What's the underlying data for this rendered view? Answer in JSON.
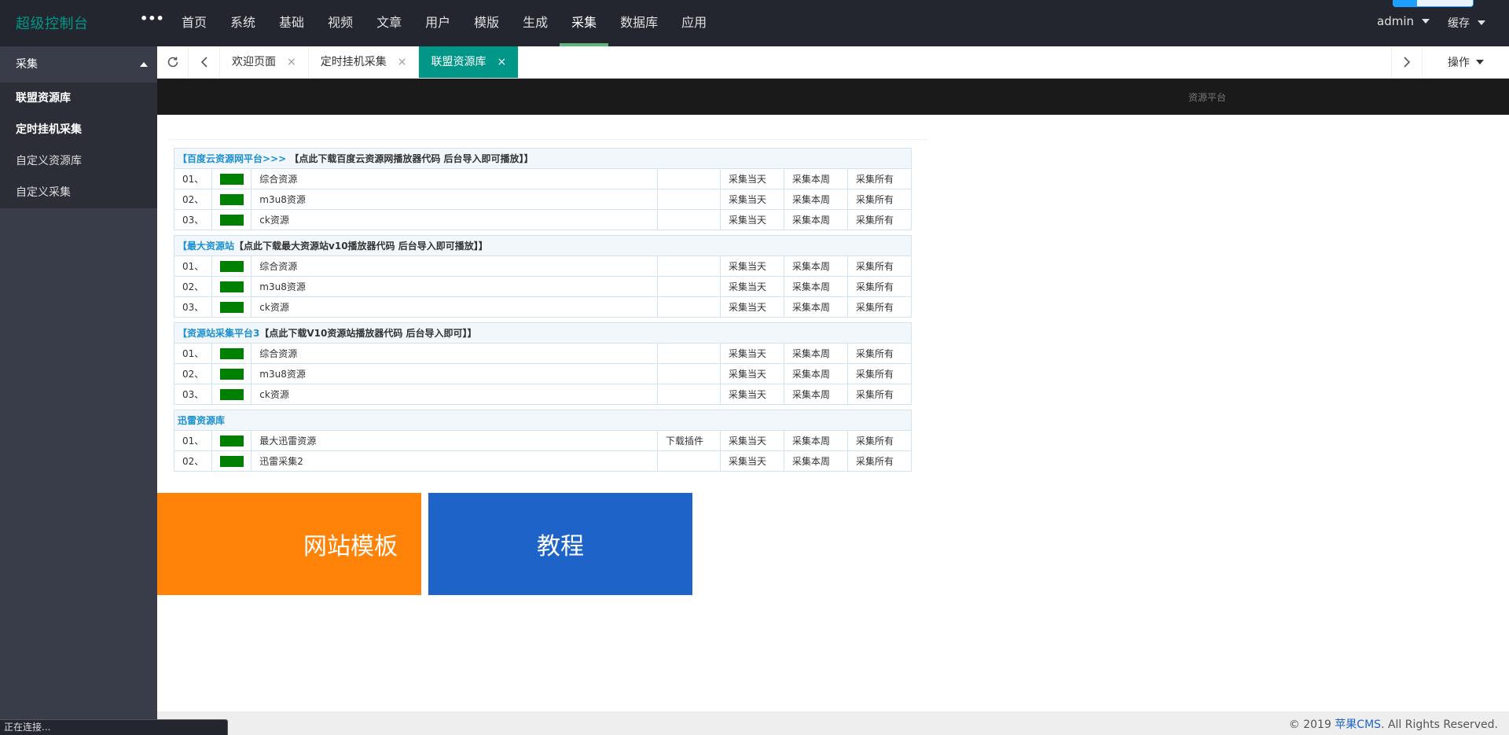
{
  "header": {
    "logo": "超级控制台",
    "more": "•••",
    "nav": [
      "首页",
      "系统",
      "基础",
      "视频",
      "文章",
      "用户",
      "模版",
      "生成",
      "采集",
      "数据库",
      "应用"
    ],
    "active_nav": "采集",
    "user": "admin",
    "cache": "缓存"
  },
  "sidebar": {
    "group": "采集",
    "items": [
      "联盟资源库",
      "定时挂机采集",
      "自定义资源库",
      "自定义采集"
    ]
  },
  "tabs": {
    "items": [
      {
        "label": "欢迎页面",
        "close": "×"
      },
      {
        "label": "定时挂机采集",
        "close": "×"
      },
      {
        "label": "联盟资源库",
        "close": "×"
      }
    ],
    "ops": "操作"
  },
  "content": {
    "darkbar_text": "资源平台",
    "swatch_color": "#008000",
    "actions": {
      "today": "采集当天",
      "week": "采集本周",
      "all": "采集所有"
    },
    "groups": [
      {
        "link": "【百度云资源网平台>>>",
        "desc": " 【点此下载百度云资源网播放器代码 后台导入即可播放】】",
        "rows": [
          {
            "num": "01、",
            "name": "综合资源",
            "plugin": ""
          },
          {
            "num": "02、",
            "name": "m3u8资源",
            "plugin": ""
          },
          {
            "num": "03、",
            "name": "ck资源",
            "plugin": ""
          }
        ]
      },
      {
        "link": "【最大资源站",
        "desc": "【点此下载最大资源站v10播放器代码 后台导入即可播放】】",
        "rows": [
          {
            "num": "01、",
            "name": "综合资源",
            "plugin": ""
          },
          {
            "num": "02、",
            "name": "m3u8资源",
            "plugin": ""
          },
          {
            "num": "03、",
            "name": "ck资源",
            "plugin": ""
          }
        ]
      },
      {
        "link": "【资源站采集平台3",
        "desc": "【点此下载V10资源站播放器代码 后台导入即可】】",
        "rows": [
          {
            "num": "01、",
            "name": "综合资源",
            "plugin": ""
          },
          {
            "num": "02、",
            "name": "m3u8资源",
            "plugin": ""
          },
          {
            "num": "03、",
            "name": "ck资源",
            "plugin": ""
          }
        ]
      },
      {
        "link": "迅雷资源库",
        "desc": "",
        "rows": [
          {
            "num": "01、",
            "name": "最大迅雷资源",
            "plugin": "下载插件"
          },
          {
            "num": "02、",
            "name": "迅雷采集2",
            "plugin": ""
          }
        ]
      }
    ],
    "promos": [
      {
        "label": "网站模板",
        "color": "#ff8308"
      },
      {
        "label": "教程",
        "color": "#1e64c8"
      }
    ]
  },
  "footer": {
    "prefix": "© 2019 ",
    "link": "苹果CMS",
    "suffix": ". All Rights Reserved."
  },
  "status": "正在连接..."
}
